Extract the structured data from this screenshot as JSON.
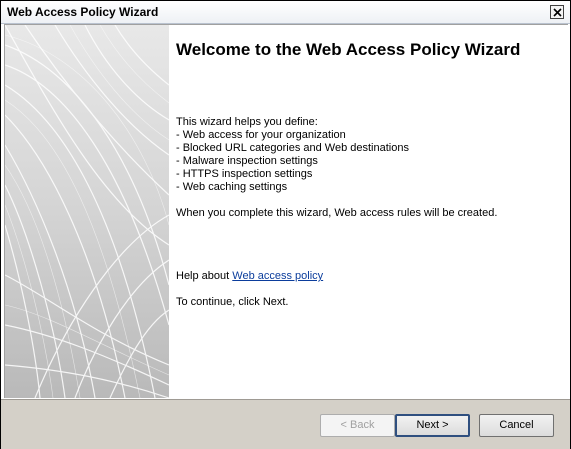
{
  "window": {
    "title": "Web Access Policy Wizard"
  },
  "main": {
    "heading": "Welcome to the Web Access Policy Wizard",
    "intro": "This wizard helps you define:",
    "items": [
      "- Web access for your organization",
      "- Blocked URL categories and Web destinations",
      "- Malware inspection settings",
      "- HTTPS inspection settings",
      "- Web caching settings"
    ],
    "completion_text": "When you complete this wizard, Web access rules will be created.",
    "help_prefix": "Help about ",
    "help_link": "Web access policy",
    "continue_text": "To continue, click Next."
  },
  "buttons": {
    "back": "< Back",
    "next": "Next >",
    "cancel": "Cancel",
    "back_enabled": false,
    "next_default": true
  },
  "icons": {
    "close": "close-icon"
  },
  "colors": {
    "link": "#0b3d9c",
    "footer": "#d4d0c8",
    "side_panel": "#d4d4d4"
  }
}
